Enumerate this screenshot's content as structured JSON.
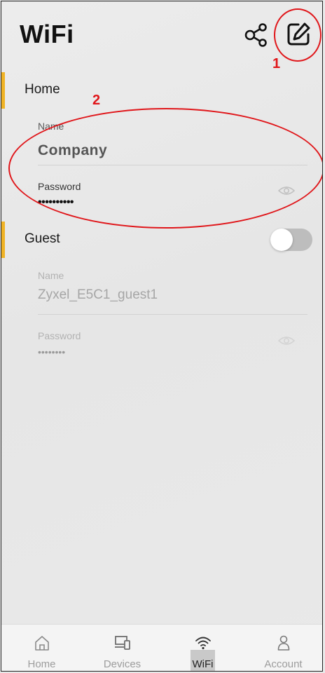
{
  "header": {
    "title": "WiFi"
  },
  "annotations": {
    "marker_1": "1",
    "marker_2": "2"
  },
  "home": {
    "section_label": "Home",
    "name_label": "Name",
    "name_value": "Company",
    "password_label": "Password",
    "password_value": "••••••••••"
  },
  "guest": {
    "section_label": "Guest",
    "enabled": false,
    "name_label": "Name",
    "name_value": "Zyxel_E5C1_guest1",
    "password_label": "Password",
    "password_value": "••••••••"
  },
  "tabs": [
    {
      "label": "Home",
      "icon": "home-icon",
      "active": false
    },
    {
      "label": "Devices",
      "icon": "devices-icon",
      "active": false
    },
    {
      "label": "WiFi",
      "icon": "wifi-icon",
      "active": true
    },
    {
      "label": "Account",
      "icon": "account-icon",
      "active": false
    }
  ],
  "colors": {
    "accent": "#f0b325",
    "annotation": "#e0161a",
    "toggle_off": "#bdbdbd"
  }
}
